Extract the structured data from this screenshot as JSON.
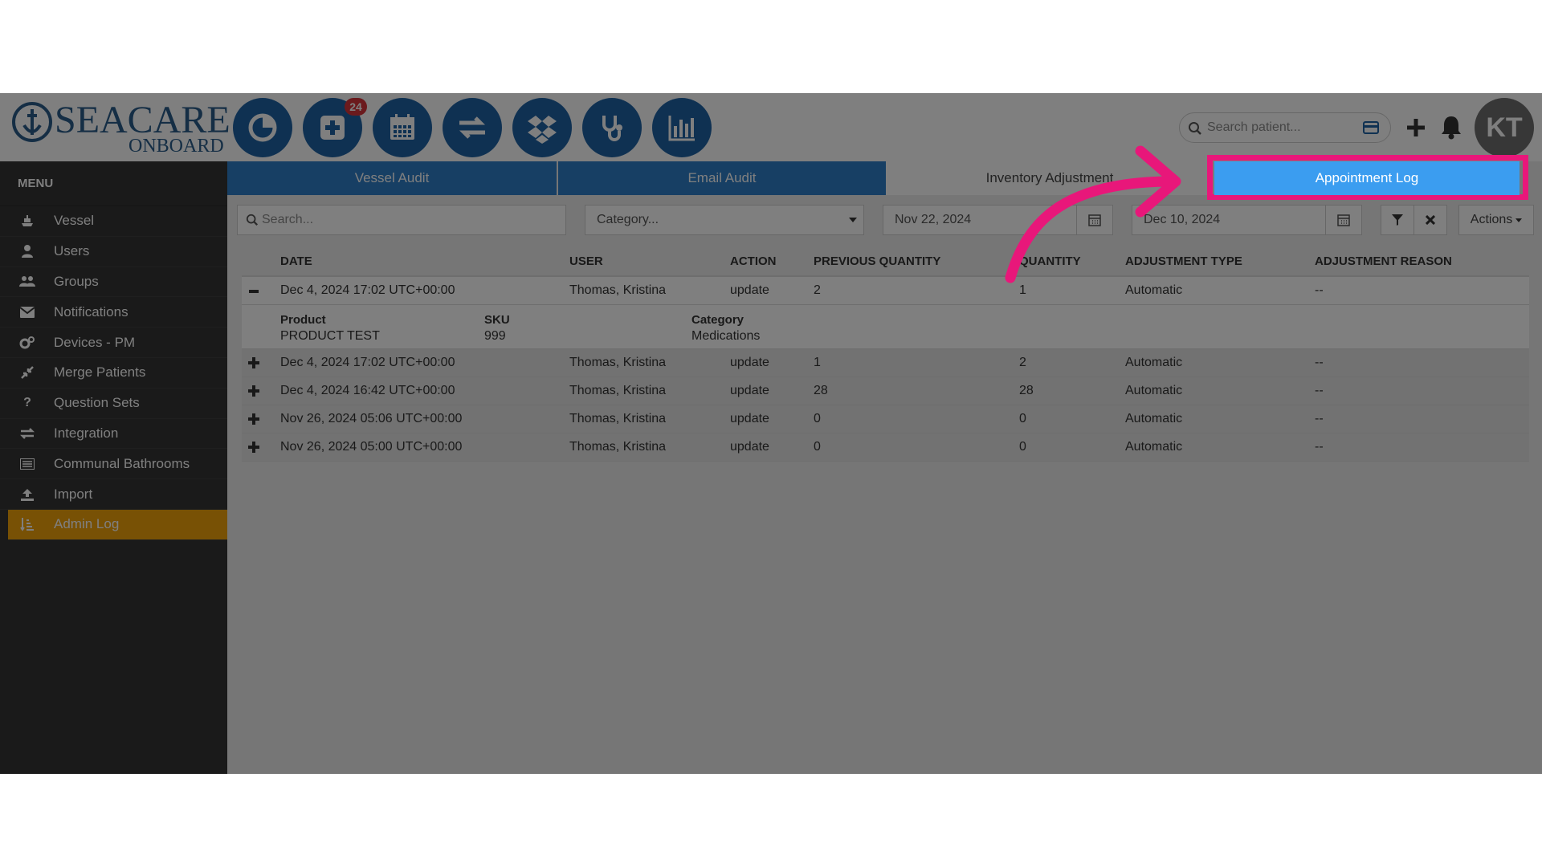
{
  "header": {
    "brand": "SEACARE",
    "brand_sub": "ONBOARD",
    "nav_icons": [
      "dashboard-pie-icon",
      "medical-plus-icon",
      "calendar-icon",
      "transfer-arrows-icon",
      "dropbox-icon",
      "stethoscope-icon",
      "bar-chart-icon"
    ],
    "badge_count": "24",
    "search_placeholder": "Search patient...",
    "avatar_initials": "KT"
  },
  "sidebar": {
    "title": "MENU",
    "items": [
      {
        "label": "Vessel",
        "icon": "ship-icon"
      },
      {
        "label": "Users",
        "icon": "user-icon"
      },
      {
        "label": "Groups",
        "icon": "users-icon"
      },
      {
        "label": "Notifications",
        "icon": "envelope-icon"
      },
      {
        "label": "Devices - PM",
        "icon": "cogs-icon"
      },
      {
        "label": "Merge Patients",
        "icon": "compress-icon"
      },
      {
        "label": "Question Sets",
        "icon": "question-icon"
      },
      {
        "label": "Integration",
        "icon": "exchange-icon"
      },
      {
        "label": "Communal Bathrooms",
        "icon": "list-icon"
      },
      {
        "label": "Import",
        "icon": "upload-icon"
      },
      {
        "label": "Admin Log",
        "icon": "sort-icon"
      }
    ]
  },
  "tabs": {
    "vessel_audit": "Vessel Audit",
    "email_audit": "Email Audit",
    "inventory_adjustment": "Inventory Adjustment",
    "appointment_log": "Appointment Log"
  },
  "toolbar": {
    "search_placeholder": "Search...",
    "category_placeholder": "Category...",
    "date_from": "Nov 22, 2024",
    "date_to": "Dec 10, 2024",
    "actions_label": "Actions"
  },
  "table": {
    "columns": [
      "DATE",
      "USER",
      "ACTION",
      "PREVIOUS QUANTITY",
      "QUANTITY",
      "ADJUSTMENT TYPE",
      "ADJUSTMENT REASON"
    ],
    "rows": [
      {
        "expanded": true,
        "date": "Dec 4, 2024 17:02 UTC+00:00",
        "user": "Thomas, Kristina",
        "action": "update",
        "prev": "2",
        "qty": "1",
        "type": "Automatic",
        "reason": "--"
      },
      {
        "expanded": false,
        "date": "Dec 4, 2024 17:02 UTC+00:00",
        "user": "Thomas, Kristina",
        "action": "update",
        "prev": "1",
        "qty": "2",
        "type": "Automatic",
        "reason": "--"
      },
      {
        "expanded": false,
        "date": "Dec 4, 2024 16:42 UTC+00:00",
        "user": "Thomas, Kristina",
        "action": "update",
        "prev": "28",
        "qty": "28",
        "type": "Automatic",
        "reason": "--"
      },
      {
        "expanded": false,
        "date": "Nov 26, 2024 05:06 UTC+00:00",
        "user": "Thomas, Kristina",
        "action": "update",
        "prev": "0",
        "qty": "0",
        "type": "Automatic",
        "reason": "--"
      },
      {
        "expanded": false,
        "date": "Nov 26, 2024 05:00 UTC+00:00",
        "user": "Thomas, Kristina",
        "action": "update",
        "prev": "0",
        "qty": "0",
        "type": "Automatic",
        "reason": "--"
      }
    ],
    "detail": {
      "product_label": "Product",
      "product_value": "PRODUCT TEST",
      "sku_label": "SKU",
      "sku_value": "999",
      "category_label": "Category",
      "category_value": "Medications"
    }
  },
  "colors": {
    "brand_blue": "#1f63a5",
    "tab_blue": "#2f7fc8",
    "highlight_pink": "#e8177a",
    "highlight_tab": "#3b9df0",
    "active_item": "#f0a20b",
    "sidebar_bg": "#343434"
  }
}
